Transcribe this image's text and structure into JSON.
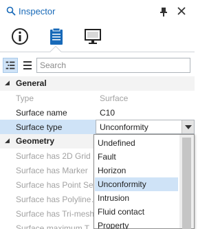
{
  "window": {
    "title": "Inspector"
  },
  "toolbar": {
    "search_placeholder": "Search"
  },
  "grid": {
    "general": {
      "label": "General",
      "rows": [
        {
          "name": "Type",
          "value": "Surface"
        },
        {
          "name": "Surface name",
          "value": "C10"
        },
        {
          "name": "Surface type",
          "value": "Unconformity"
        }
      ]
    },
    "geometry": {
      "label": "Geometry",
      "rows": [
        {
          "name": "Surface has 2D Grid"
        },
        {
          "name": "Surface has Marker"
        },
        {
          "name": "Surface has Point Set"
        },
        {
          "name": "Surface has Polyline…"
        },
        {
          "name": "Surface has Tri-mesh"
        },
        {
          "name": "Surface maximum T…"
        }
      ]
    }
  },
  "dropdown": {
    "options": [
      "Undefined",
      "Fault",
      "Horizon",
      "Unconformity",
      "Intrusion",
      "Fluid contact",
      "Property"
    ],
    "selected": "Unconformity"
  },
  "colors": {
    "accent": "#1769b8",
    "selection": "#cfe3f7"
  }
}
